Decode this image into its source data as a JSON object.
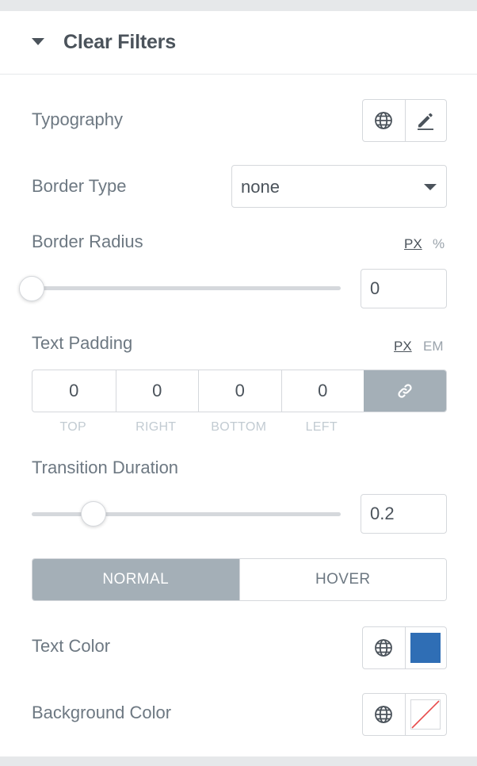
{
  "section": {
    "title": "Clear Filters"
  },
  "typography": {
    "label": "Typography",
    "icons": [
      "globe-icon",
      "pencil-icon"
    ]
  },
  "border_type": {
    "label": "Border Type",
    "value": "none"
  },
  "border_radius": {
    "label": "Border Radius",
    "units": [
      "PX",
      "%"
    ],
    "active_unit": "PX",
    "value": "0",
    "slider_fraction": 0.0
  },
  "text_padding": {
    "label": "Text Padding",
    "units": [
      "PX",
      "EM"
    ],
    "active_unit": "PX",
    "values": [
      "0",
      "0",
      "0",
      "0"
    ],
    "sides": [
      "TOP",
      "RIGHT",
      "BOTTOM",
      "LEFT"
    ],
    "link_icon": "link-icon"
  },
  "transition": {
    "label": "Transition Duration",
    "value": "0.2",
    "slider_fraction": 0.2
  },
  "state_tabs": {
    "normal": "NORMAL",
    "hover": "HOVER",
    "active": "NORMAL"
  },
  "text_color": {
    "label": "Text Color",
    "color": "#2f6eb5"
  },
  "background_color": {
    "label": "Background Color",
    "color": "none"
  },
  "colors": {
    "accent_gray": "#a4afb7",
    "border": "#d5d8dc",
    "text": "#6d7882",
    "strike": "#e84b4b"
  }
}
